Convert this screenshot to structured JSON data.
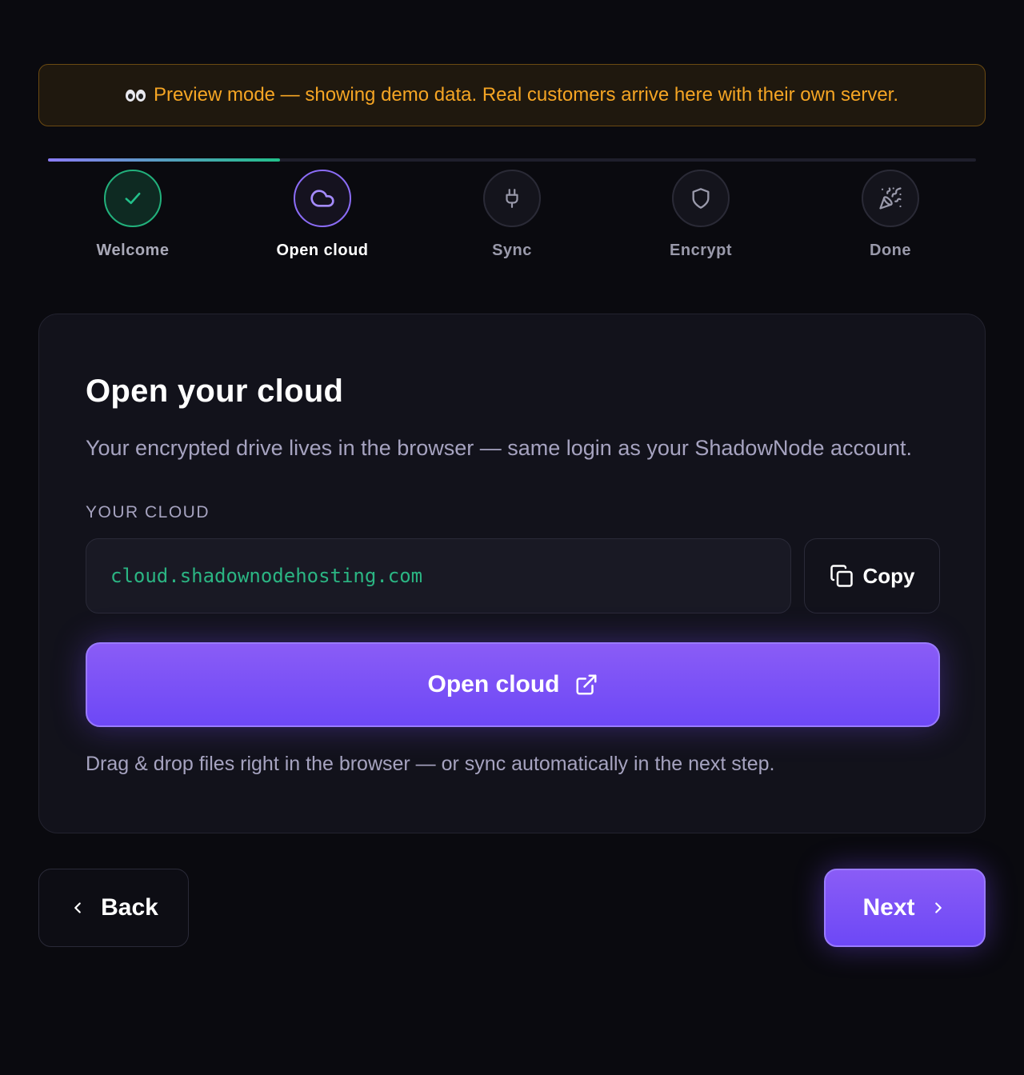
{
  "banner": {
    "icon": "eyes-icon",
    "text": "Preview mode — showing demo data. Real customers arrive here with their own server.",
    "color": "#f5a524"
  },
  "stepper": {
    "progress_fraction": 0.25,
    "steps": [
      {
        "label": "Welcome",
        "icon": "check-icon",
        "state": "done"
      },
      {
        "label": "Open cloud",
        "icon": "cloud-icon",
        "state": "active"
      },
      {
        "label": "Sync",
        "icon": "plug-icon",
        "state": "pending"
      },
      {
        "label": "Encrypt",
        "icon": "shield-icon",
        "state": "pending"
      },
      {
        "label": "Done",
        "icon": "party-popper-icon",
        "state": "pending"
      }
    ]
  },
  "card": {
    "title": "Open your cloud",
    "subtitle": "Your encrypted drive lives in the browser — same login as your ShadowNode account.",
    "field_label": "YOUR CLOUD",
    "cloud_url": "cloud.shadownodehosting.com",
    "copy_label": "Copy",
    "open_label": "Open cloud",
    "hint": "Drag & drop files right in the browser — or sync automatically in the next step."
  },
  "footer": {
    "back_label": "Back",
    "next_label": "Next"
  },
  "colors": {
    "accent": "#7c4dff",
    "success": "#22b17c",
    "background": "#0a0a0f"
  }
}
